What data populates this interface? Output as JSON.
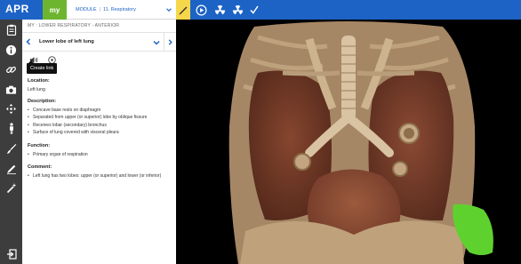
{
  "topbar": {
    "logo": "APR",
    "my_label": "my",
    "module_prefix": "MODULE",
    "module_sep": "|",
    "module_title": "11. Respiratory",
    "colors": {
      "blue": "#1d63c6",
      "green": "#6eb52f",
      "yellow": "#f6d74a"
    },
    "icons": [
      "pen-icon",
      "play-icon",
      "radiation-icon",
      "radiation-icon",
      "check-icon"
    ]
  },
  "rail": {
    "icons": [
      "clipboard-icon",
      "info-icon",
      "link-icon",
      "camera-icon",
      "move-icon",
      "body-icon",
      "brush-icon",
      "pencil-icon",
      "wand-icon",
      "exit-icon"
    ]
  },
  "panel": {
    "breadcrumb": "MY : LOWER RESPIRATORY - ANTERIOR",
    "view_title": "Lower lobe of left lung",
    "tooltip": "Create link",
    "sections": {
      "location": {
        "heading": "Location:",
        "text": "Left lung"
      },
      "description": {
        "heading": "Description:",
        "items": [
          "Concave base rests on diaphragm",
          "Separated from upper (or superior) lobe by oblique fissure",
          "Receives lobar (secondary) bronchus",
          "Surface of lung covered with visceral pleura"
        ]
      },
      "function": {
        "heading": "Function:",
        "items": [
          "Primary organ of respiration"
        ]
      },
      "comment": {
        "heading": "Comment:",
        "items": [
          "Left lung has two lobes: upper (or superior) and lower (or inferior)"
        ]
      }
    }
  }
}
